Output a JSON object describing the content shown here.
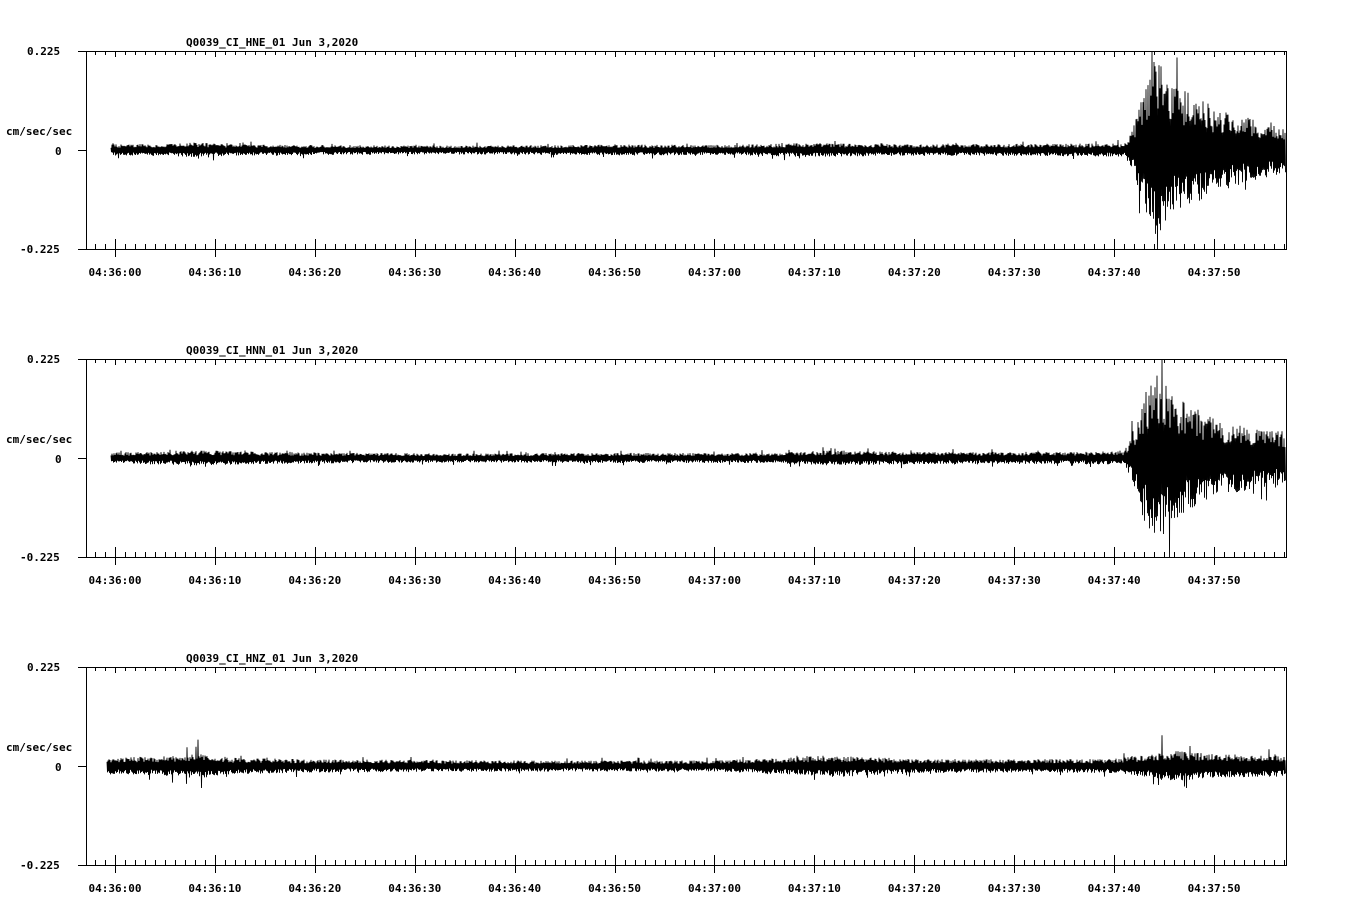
{
  "chart_data": [
    {
      "type": "line",
      "title": "Q0039_CI_HNE_01  Jun 3,2020",
      "ylabel": "cm/sec/sec",
      "ylim": [
        -0.225,
        0.225
      ],
      "yticks": [
        "0.225",
        "0",
        "-0.225"
      ],
      "xticks": [
        "04:36:00",
        "04:36:10",
        "04:36:20",
        "04:36:30",
        "04:36:40",
        "04:36:50",
        "04:37:00",
        "04:37:10",
        "04:37:20",
        "04:37:30",
        "04:37:40",
        "04:37:50"
      ],
      "grid": false,
      "legend": "none",
      "series": [
        {
          "x_range_s": [
            -1.5,
            58.5
          ],
          "data_start_s": -0.4,
          "p_arrival_s": 101.5,
          "envelope": [
            {
              "t": -0.4,
              "amp": 0.011
            },
            {
              "t": 5.0,
              "amp": 0.012
            },
            {
              "t": 8.0,
              "amp": 0.015
            },
            {
              "t": 12.0,
              "amp": 0.011
            },
            {
              "t": 20.0,
              "amp": 0.01
            },
            {
              "t": 30.0,
              "amp": 0.009
            },
            {
              "t": 40.0,
              "amp": 0.009
            },
            {
              "t": 50.0,
              "amp": 0.011
            },
            {
              "t": 60.0,
              "amp": 0.01
            },
            {
              "t": 70.0,
              "amp": 0.014
            },
            {
              "t": 80.0,
              "amp": 0.011
            },
            {
              "t": 90.0,
              "amp": 0.012
            },
            {
              "t": 101.0,
              "amp": 0.013
            },
            {
              "t": 102.0,
              "amp": 0.05
            },
            {
              "t": 103.0,
              "amp": 0.12
            },
            {
              "t": 104.2,
              "amp": 0.18
            },
            {
              "t": 106.0,
              "amp": 0.13
            },
            {
              "t": 110.0,
              "amp": 0.085
            },
            {
              "t": 114.0,
              "amp": 0.06
            },
            {
              "t": 118.5,
              "amp": 0.045
            }
          ],
          "peaks": [
            {
              "t": 104.0,
              "y": 0.2
            },
            {
              "t": 104.3,
              "y": -0.24
            },
            {
              "t": 104.7,
              "y": 0.19
            },
            {
              "t": 103.6,
              "y": -0.15
            }
          ]
        }
      ]
    },
    {
      "type": "line",
      "title": "Q0039_CI_HNN_01  Jun 3,2020",
      "ylabel": "cm/sec/sec",
      "ylim": [
        -0.225,
        0.225
      ],
      "yticks": [
        "0.225",
        "0",
        "-0.225"
      ],
      "xticks": [
        "04:36:00",
        "04:36:10",
        "04:36:20",
        "04:36:30",
        "04:36:40",
        "04:36:50",
        "04:37:00",
        "04:37:10",
        "04:37:20",
        "04:37:30",
        "04:37:40",
        "04:37:50"
      ],
      "grid": false,
      "legend": "none",
      "series": [
        {
          "data_start_s": -0.4,
          "p_arrival_s": 101.5,
          "envelope": [
            {
              "t": -0.4,
              "amp": 0.011
            },
            {
              "t": 5.0,
              "amp": 0.013
            },
            {
              "t": 9.0,
              "amp": 0.015
            },
            {
              "t": 15.0,
              "amp": 0.012
            },
            {
              "t": 25.0,
              "amp": 0.01
            },
            {
              "t": 35.0,
              "amp": 0.009
            },
            {
              "t": 45.0,
              "amp": 0.01
            },
            {
              "t": 55.0,
              "amp": 0.01
            },
            {
              "t": 65.0,
              "amp": 0.01
            },
            {
              "t": 72.0,
              "amp": 0.015
            },
            {
              "t": 80.0,
              "amp": 0.012
            },
            {
              "t": 90.0,
              "amp": 0.012
            },
            {
              "t": 101.0,
              "amp": 0.013
            },
            {
              "t": 102.0,
              "amp": 0.06
            },
            {
              "t": 103.0,
              "amp": 0.13
            },
            {
              "t": 104.5,
              "amp": 0.17
            },
            {
              "t": 106.0,
              "amp": 0.12
            },
            {
              "t": 110.0,
              "amp": 0.08
            },
            {
              "t": 114.0,
              "amp": 0.06
            },
            {
              "t": 118.5,
              "amp": 0.05
            }
          ],
          "peaks": [
            {
              "t": 104.8,
              "y": 0.225
            },
            {
              "t": 103.2,
              "y": 0.15
            },
            {
              "t": 104.0,
              "y": -0.17
            },
            {
              "t": 103.5,
              "y": -0.16
            }
          ]
        }
      ]
    },
    {
      "type": "line",
      "title": "Q0039_CI_HNZ_01  Jun 3,2020",
      "ylabel": "cm/sec/sec",
      "ylim": [
        -0.225,
        0.225
      ],
      "yticks": [
        "0.225",
        "0",
        "-0.225"
      ],
      "xticks": [
        "04:36:00",
        "04:36:10",
        "04:36:20",
        "04:36:30",
        "04:36:40",
        "04:36:50",
        "04:37:00",
        "04:37:10",
        "04:37:20",
        "04:37:30",
        "04:37:40",
        "04:37:50"
      ],
      "grid": false,
      "legend": "none",
      "series": [
        {
          "data_start_s": -0.8,
          "p_arrival_s": 101.5,
          "envelope": [
            {
              "t": -0.8,
              "amp": 0.017
            },
            {
              "t": 4.0,
              "amp": 0.018
            },
            {
              "t": 8.0,
              "amp": 0.025
            },
            {
              "t": 12.0,
              "amp": 0.016
            },
            {
              "t": 20.0,
              "amp": 0.013
            },
            {
              "t": 30.0,
              "amp": 0.012
            },
            {
              "t": 40.0,
              "amp": 0.011
            },
            {
              "t": 50.0,
              "amp": 0.011
            },
            {
              "t": 60.0,
              "amp": 0.011
            },
            {
              "t": 67.0,
              "amp": 0.016
            },
            {
              "t": 72.0,
              "amp": 0.022
            },
            {
              "t": 80.0,
              "amp": 0.014
            },
            {
              "t": 90.0,
              "amp": 0.013
            },
            {
              "t": 100.0,
              "amp": 0.014
            },
            {
              "t": 103.0,
              "amp": 0.022
            },
            {
              "t": 106.0,
              "amp": 0.03
            },
            {
              "t": 110.0,
              "amp": 0.024
            },
            {
              "t": 118.5,
              "amp": 0.02
            }
          ],
          "peaks": [
            {
              "t": 8.3,
              "y": 0.06
            },
            {
              "t": 8.6,
              "y": -0.05
            },
            {
              "t": 104.8,
              "y": 0.07
            },
            {
              "t": 107.2,
              "y": -0.05
            }
          ]
        }
      ]
    }
  ]
}
